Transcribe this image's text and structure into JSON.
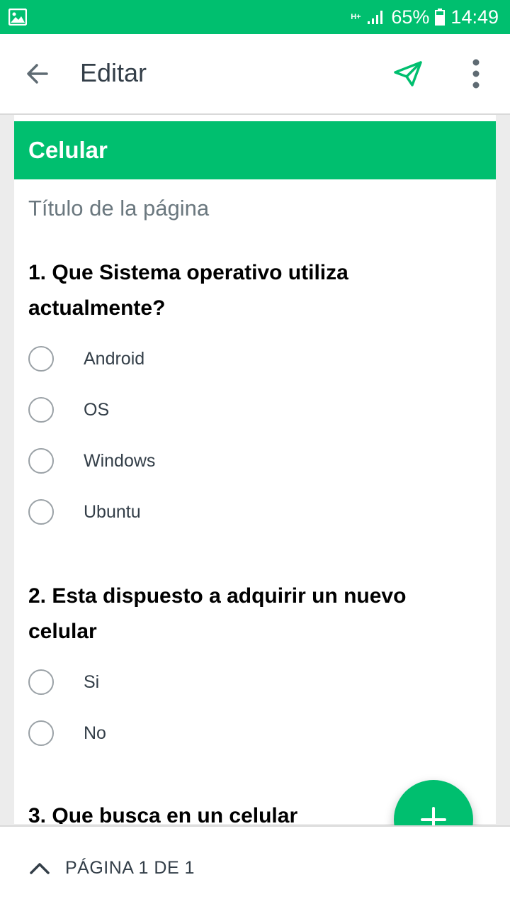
{
  "status_bar": {
    "network_type": "H+",
    "battery_percent": "65%",
    "time": "14:49",
    "icons": [
      "image-icon",
      "signal-icon",
      "battery-icon"
    ]
  },
  "app_bar": {
    "title": "Editar",
    "icons": [
      "back-arrow-icon",
      "send-icon",
      "more-vert-icon"
    ]
  },
  "survey": {
    "page_header": "Celular",
    "page_title_placeholder": "Título de la página",
    "questions": [
      {
        "title": "1. Que Sistema operativo utiliza actualmente?",
        "options": [
          "Android",
          "OS",
          "Windows",
          "Ubuntu"
        ]
      },
      {
        "title": "2. Esta dispuesto a adquirir un nuevo celular",
        "options": [
          "Si",
          "No"
        ]
      },
      {
        "title": "3. Que busca en un celular",
        "options": []
      }
    ]
  },
  "bottom_bar": {
    "page_indicator": "PÁGINA 1 DE 1"
  },
  "colors": {
    "brand_green": "#00bf6f",
    "text_dark": "#333e48",
    "text_muted": "#6b787f"
  }
}
